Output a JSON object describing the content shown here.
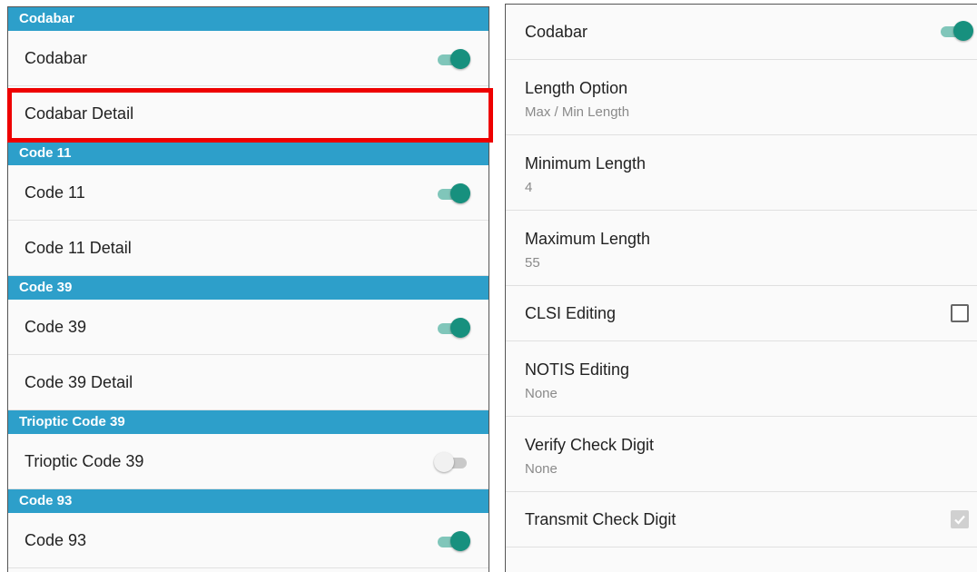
{
  "left_panel": {
    "sections": [
      {
        "header": "Codabar",
        "rows": [
          {
            "label": "Codabar",
            "control": "switch",
            "on": true
          },
          {
            "label": "Codabar Detail",
            "control": "none"
          }
        ]
      },
      {
        "header": "Code 11",
        "rows": [
          {
            "label": "Code 11",
            "control": "switch",
            "on": true
          },
          {
            "label": "Code 11 Detail",
            "control": "none"
          }
        ]
      },
      {
        "header": "Code 39",
        "rows": [
          {
            "label": "Code 39",
            "control": "switch",
            "on": true
          },
          {
            "label": "Code 39 Detail",
            "control": "none"
          }
        ]
      },
      {
        "header": "Trioptic Code 39",
        "rows": [
          {
            "label": "Trioptic Code 39",
            "control": "switch",
            "on": false
          }
        ]
      },
      {
        "header": "Code 93",
        "rows": [
          {
            "label": "Code 93",
            "control": "switch",
            "on": true
          }
        ]
      }
    ]
  },
  "right_panel": {
    "items": [
      {
        "title": "Codabar",
        "summary": "",
        "control": "switch",
        "on": true
      },
      {
        "title": "Length Option",
        "summary": "Max / Min Length",
        "control": "none"
      },
      {
        "title": "Minimum Length",
        "summary": "4",
        "control": "none"
      },
      {
        "title": "Maximum Length",
        "summary": "55",
        "control": "none"
      },
      {
        "title": "CLSI Editing",
        "summary": "",
        "control": "checkbox",
        "checked": false,
        "enabled": true
      },
      {
        "title": "NOTIS Editing",
        "summary": "None",
        "control": "none"
      },
      {
        "title": "Verify Check Digit",
        "summary": "None",
        "control": "none"
      },
      {
        "title": "Transmit Check Digit",
        "summary": "",
        "control": "checkbox",
        "checked": true,
        "enabled": false
      }
    ]
  },
  "colors": {
    "section_header": "#2d9fca",
    "switch_on": "#17907e",
    "highlight_border": "#ee0000"
  }
}
